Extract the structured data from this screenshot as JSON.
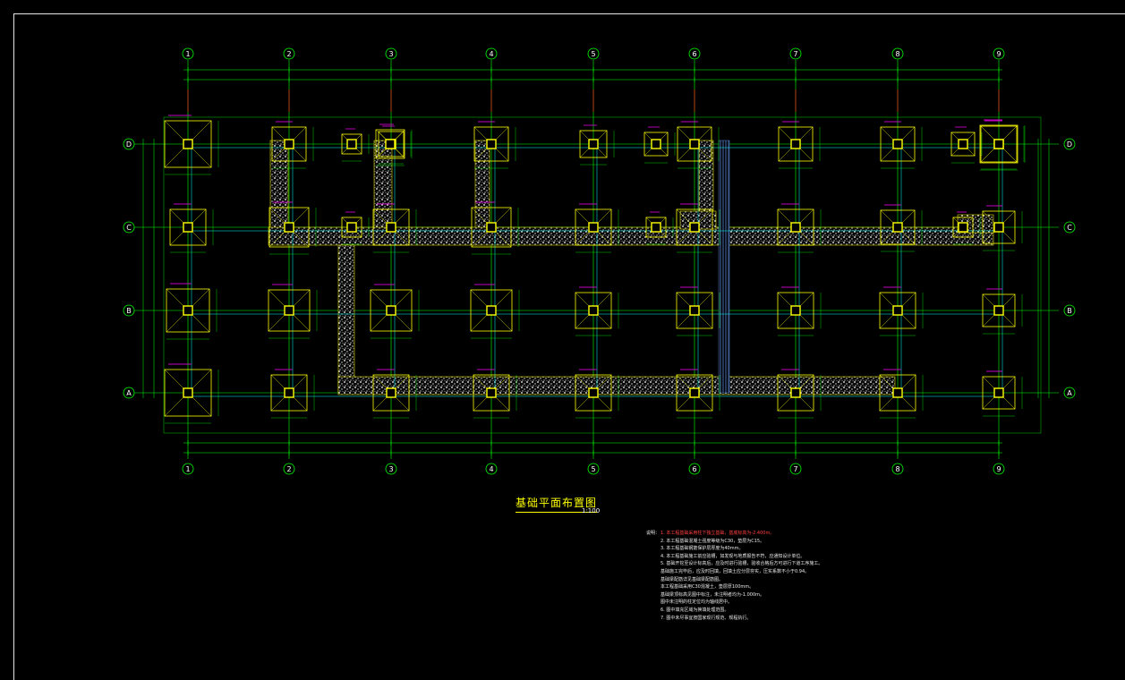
{
  "drawing": {
    "title": "基础平面布置图",
    "scale": "1:100",
    "grid_columns": [
      "1",
      "2",
      "3",
      "4",
      "5",
      "6",
      "7",
      "8",
      "9"
    ],
    "grid_rows": [
      "D",
      "C",
      "B",
      "A"
    ],
    "notes_heading": "说明：",
    "notes": [
      "1. 本工程基础采用柱下独立基础，基底标高为-2.400m。",
      "2. 本工程基础混凝土强度等级为C30，垫层为C15。",
      "3. 本工程基础钢筋保护层厚度为40mm。",
      "4. 本工程基础施工前应验槽，如发现与地质报告不符，应通知设计单位。",
      "5. 基础开挖至设计标高后，应及时进行验槽，验收合格后方可进行下道工序施工。",
      "   基础施工完毕后，应及时回填，回填土应分层夯实，压实系数不小于0.94。",
      "   基础梁配筋详见基础梁配筋图。",
      "   本工程基础采用C30混凝土，垫层厚100mm。",
      "   基础梁顶标高见图中标注，未注明者均为-1.000m。",
      "   图中未注明的柱定位均为轴线居中。",
      "6. 图中填充区域为换填处理范围。",
      "7. 图中未尽事宜按国家现行规范、规程执行。"
    ],
    "colors": {
      "grid": "#00ff00",
      "footing": "#ffff00",
      "dimension": "#00ff00",
      "annotation": "#ff00ff",
      "beam": "#00ffff",
      "fill": "#ffffff",
      "background": "#000000"
    }
  }
}
